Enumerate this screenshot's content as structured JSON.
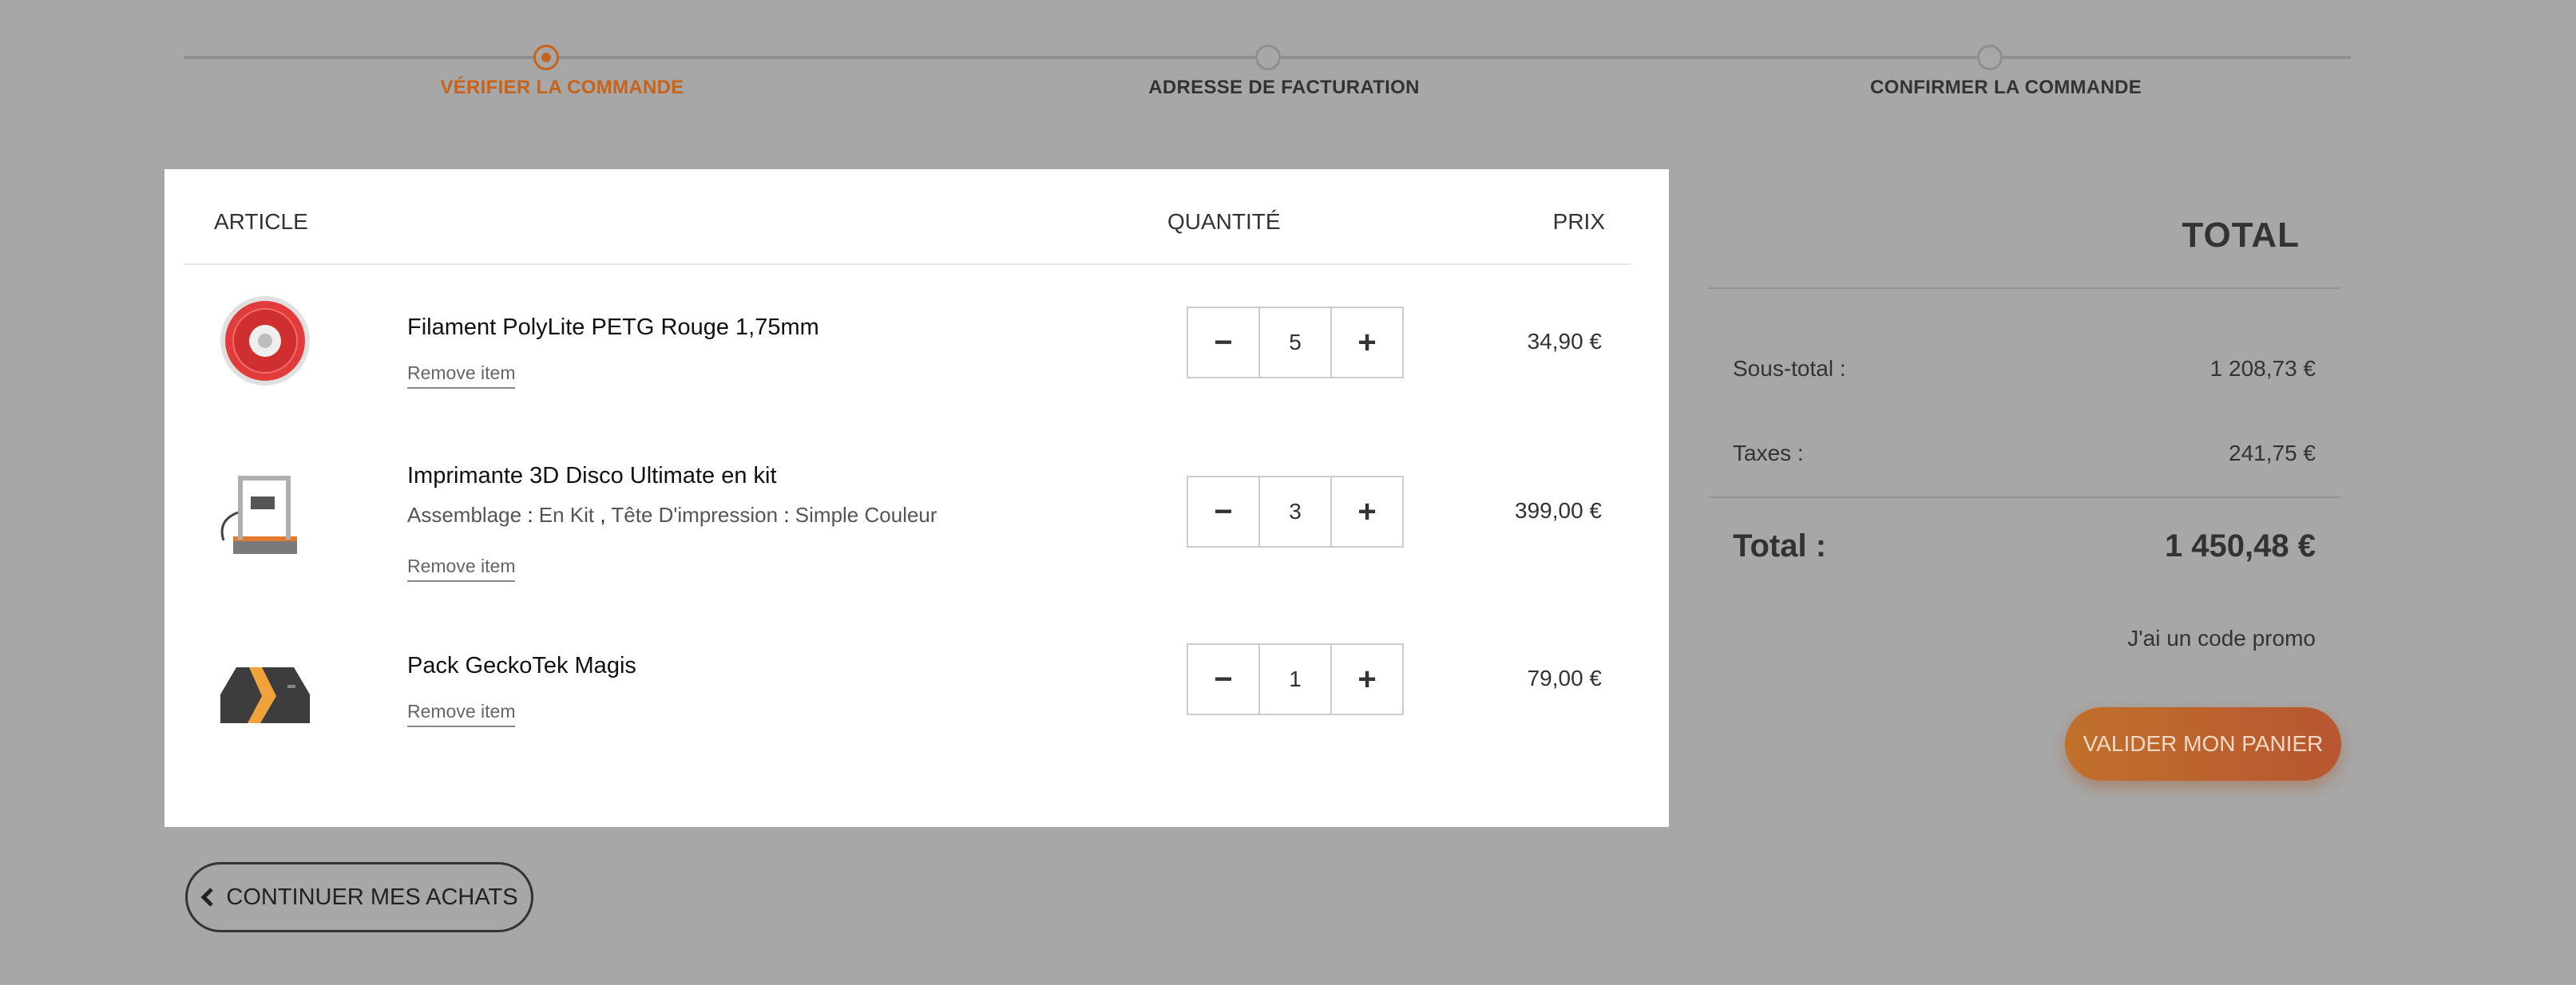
{
  "stepper": [
    {
      "label": "VÉRIFIER LA COMMANDE",
      "active": true
    },
    {
      "label": "ADRESSE DE FACTURATION",
      "active": false
    },
    {
      "label": "CONFIRMER LA COMMANDE",
      "active": false
    }
  ],
  "cart": {
    "headers": {
      "article": "ARTICLE",
      "quantity": "QUANTITÉ",
      "price": "PRIX"
    },
    "items": [
      {
        "name": "Filament PolyLite PETG Rouge 1,75mm",
        "remove": "Remove item",
        "qty": "5",
        "price": "34,90 €",
        "minus": "−",
        "plus": "+"
      },
      {
        "name": "Imprimante 3D Disco Ultimate en kit",
        "remove": "Remove item",
        "qty": "3",
        "price": "399,00 €",
        "minus": "−",
        "plus": "+",
        "options": [
          {
            "label": "Assemblage",
            "value": "En Kit"
          },
          {
            "label": "Tête D'impression",
            "value": "Simple Couleur"
          }
        ]
      },
      {
        "name": "Pack GeckoTek Magis",
        "remove": "Remove item",
        "qty": "1",
        "price": "79,00 €",
        "minus": "−",
        "plus": "+"
      }
    ]
  },
  "totals": {
    "title": "TOTAL",
    "subtotal_label": "Sous-total :",
    "subtotal": "1 208,73 €",
    "tax_label": "Taxes :",
    "tax": "241,75 €",
    "total_label": "Total :",
    "total": "1 450,48 €",
    "promo": "J'ai un code promo",
    "validate": "VALIDER MON PANIER"
  },
  "continue_label": "CONTINUER MES ACHATS",
  "colors": {
    "accent": "#c6641b",
    "button": "#c1702c"
  }
}
